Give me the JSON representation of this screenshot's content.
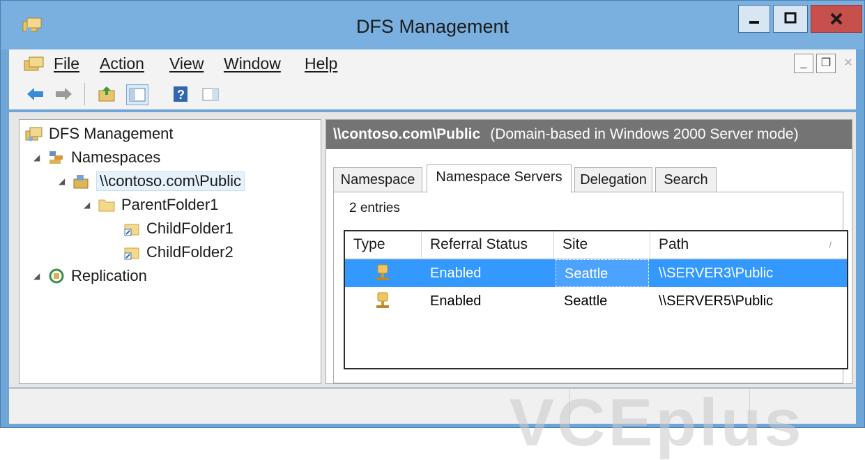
{
  "window": {
    "title": "DFS Management"
  },
  "menu": {
    "file": "File",
    "action": "Action",
    "view": "View",
    "window": "Window",
    "help": "Help"
  },
  "tree": {
    "root": "DFS Management",
    "namespaces": "Namespaces",
    "namespace_root": "\\\\contoso.com\\Public",
    "parent_folder": "ParentFolder1",
    "child1": "ChildFolder1",
    "child2": "ChildFolder2",
    "replication": "Replication"
  },
  "detail": {
    "path": "\\\\contoso.com\\Public",
    "mode": "(Domain-based in Windows 2000 Server mode)",
    "tabs": [
      "Namespace",
      "Namespace Servers",
      "Delegation",
      "Search"
    ],
    "active_tab": "Namespace Servers",
    "entries": "2 entries",
    "columns": [
      "Type",
      "Referral Status",
      "Site",
      "Path"
    ],
    "rows": [
      {
        "referral_status": "Enabled",
        "site": "Seattle",
        "path": "\\\\SERVER3\\Public",
        "selected": true
      },
      {
        "referral_status": "Enabled",
        "site": "Seattle",
        "path": "\\\\SERVER5\\Public",
        "selected": false
      }
    ]
  },
  "watermark": "VCEplus",
  "colors": {
    "title_bar": "#79b0e0",
    "selection": "#3399ff",
    "header_bar": "#747474",
    "close_button": "#c7504c"
  }
}
